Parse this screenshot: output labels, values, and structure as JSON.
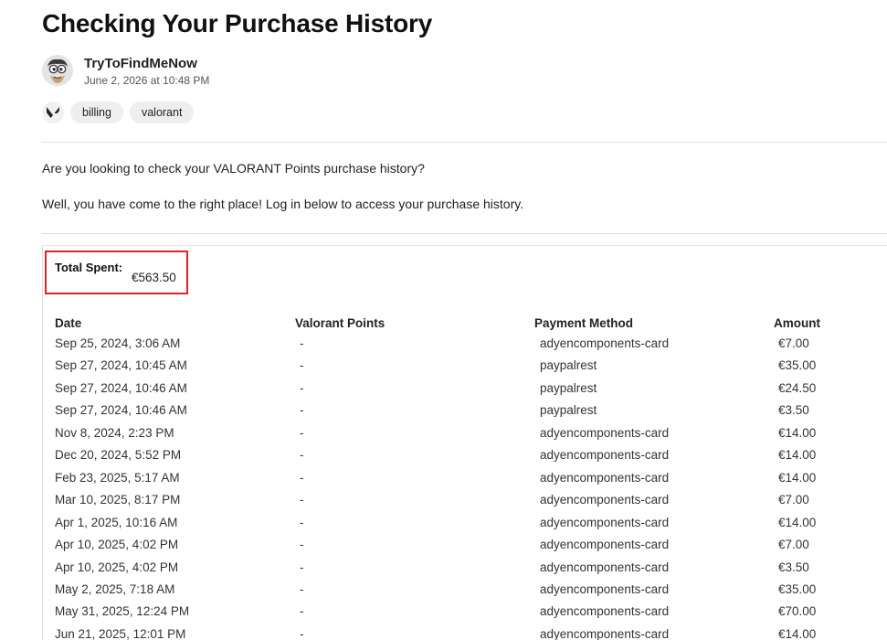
{
  "article": {
    "title": "Checking Your Purchase History",
    "author": "TryToFindMeNow",
    "date": "June 2, 2026 at 10:48 PM",
    "avatar_icon": "cartoon-character-avatar",
    "game_icon": "valorant-icon",
    "tags": [
      "billing",
      "valorant"
    ],
    "paragraphs": [
      "Are you looking to check your VALORANT Points purchase history?",
      "Well, you have come to the right place! Log in below to access your purchase history."
    ]
  },
  "summary": {
    "total_label": "Total Spent:",
    "total_value": "€563.50",
    "highlight_color": "#d9262a"
  },
  "table": {
    "headers": [
      "Date",
      "Valorant Points",
      "Payment Method",
      "Amount"
    ],
    "rows": [
      [
        "Sep 25, 2024, 3:06 AM",
        "-",
        "adyencomponents-card",
        "€7.00"
      ],
      [
        "Sep 27, 2024, 10:45 AM",
        "-",
        "paypalrest",
        "€35.00"
      ],
      [
        "Sep 27, 2024, 10:46 AM",
        "-",
        "paypalrest",
        "€24.50"
      ],
      [
        "Sep 27, 2024, 10:46 AM",
        "-",
        "paypalrest",
        "€3.50"
      ],
      [
        "Nov 8, 2024, 2:23 PM",
        "-",
        "adyencomponents-card",
        "€14.00"
      ],
      [
        "Dec 20, 2024, 5:52 PM",
        "-",
        "adyencomponents-card",
        "€14.00"
      ],
      [
        "Feb 23, 2025, 5:17 AM",
        "-",
        "adyencomponents-card",
        "€14.00"
      ],
      [
        "Mar 10, 2025, 8:17 PM",
        "-",
        "adyencomponents-card",
        "€7.00"
      ],
      [
        "Apr 1, 2025, 10:16 AM",
        "-",
        "adyencomponents-card",
        "€14.00"
      ],
      [
        "Apr 10, 2025, 4:02 PM",
        "-",
        "adyencomponents-card",
        "€7.00"
      ],
      [
        "Apr 10, 2025, 4:02 PM",
        "-",
        "adyencomponents-card",
        "€3.50"
      ],
      [
        "May 2, 2025, 7:18 AM",
        "-",
        "adyencomponents-card",
        "€35.00"
      ],
      [
        "May 31, 2025, 12:24 PM",
        "-",
        "adyencomponents-card",
        "€70.00"
      ],
      [
        "Jun 21, 2025, 12:01 PM",
        "-",
        "adyencomponents-card",
        "€14.00"
      ]
    ]
  }
}
